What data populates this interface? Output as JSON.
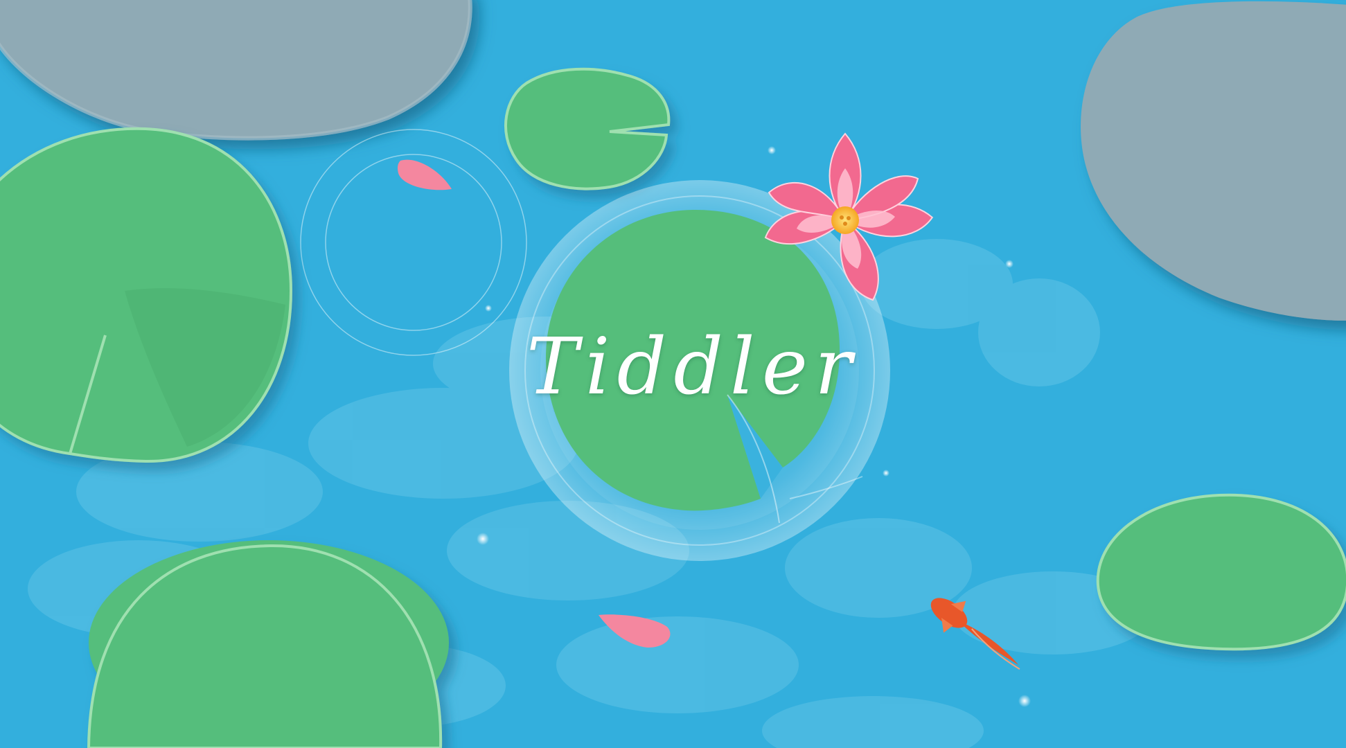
{
  "game": {
    "title": "Tiddler"
  },
  "colors": {
    "water": "#33afdd",
    "water_shadow": "#5ec2e6",
    "lily_pad": "#55be7b",
    "lily_pad_edge": "#a8e6b4",
    "rock": "#8faab5",
    "lotus_petal": "#f2698f",
    "lotus_center": "#f7c948",
    "fish": "#e8572a",
    "petal": "#f4879f"
  },
  "scene_objects": {
    "lily_pads": 5,
    "rocks": 2,
    "floating_petals": 2,
    "fish": 1,
    "lotus_flowers": 1
  }
}
